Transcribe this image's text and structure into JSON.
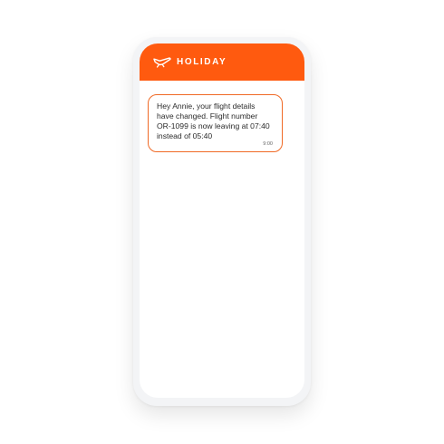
{
  "app": {
    "brand_name": "HOLIDAY",
    "logo_icon": "plane-logo-icon",
    "accent_color": "#ff5a0f"
  },
  "messages": [
    {
      "text": "Hey Annie, your flight details have changed. Flight number OR-1099 is now leaving at 07:40 instead of 05:40",
      "time": "9:00"
    }
  ]
}
